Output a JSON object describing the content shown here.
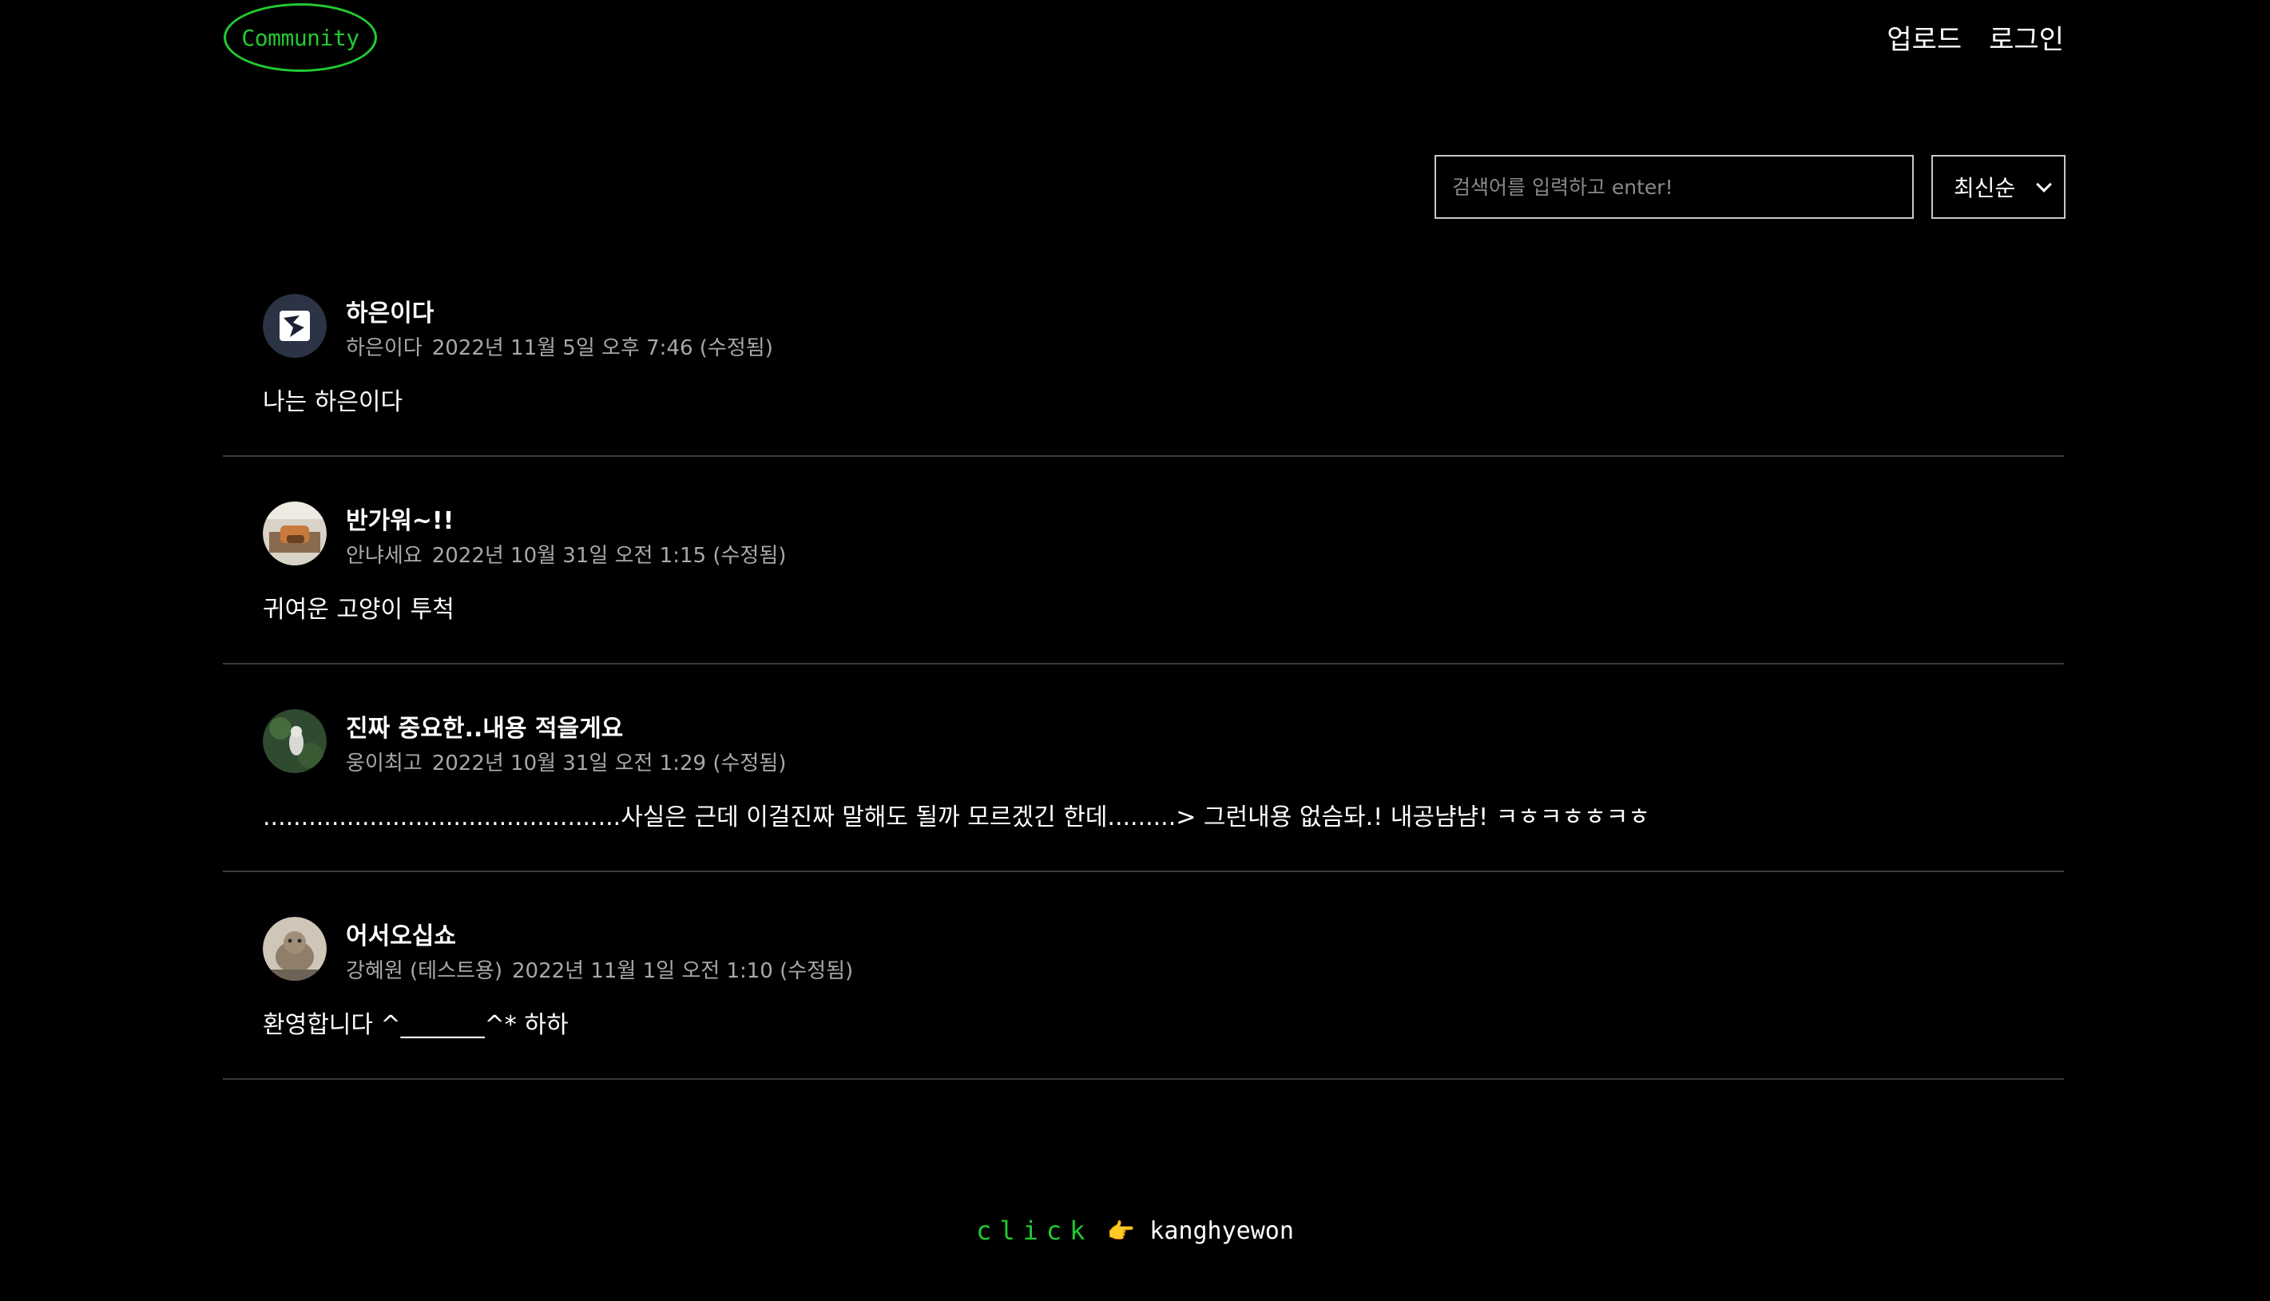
{
  "header": {
    "logo": "Community",
    "nav": [
      {
        "label": "업로드"
      },
      {
        "label": "로그인"
      }
    ]
  },
  "controls": {
    "search_placeholder": "검색어를 입력하고 enter!",
    "search_value": "",
    "sort_selected": "최신순"
  },
  "posts": [
    {
      "title": "하은이다",
      "author": "하은이다",
      "date": "2022년 11월 5일 오후 7:46 (수정됨)",
      "body": "나는 하은이다"
    },
    {
      "title": "반가워~!!",
      "author": "안냐세요",
      "date": "2022년 10월 31일 오전 1:15 (수정됨)",
      "body": "귀여운 고양이 투척"
    },
    {
      "title": "진짜 중요한..내용 적을게요",
      "author": "웅이최고",
      "date": "2022년 10월 31일 오전 1:29 (수정됨)",
      "body": "...............................................사실은 근데 이걸진짜 말해도 될까 모르겠긴 한데.........> 그런내용 없슴돠.! 내공냠냠! ㅋㅎㅋㅎㅎㅋㅎ"
    },
    {
      "title": "어서오십쇼",
      "author": "강혜원 (테스트용)",
      "date": "2022년 11월 1일 오전 1:10 (수정됨)",
      "body": "환영합니다 ^_______^* 하하"
    }
  ],
  "footer": {
    "click_text": "click",
    "icon": "pointing-hand-icon",
    "author_link": "kanghyewon"
  },
  "colors": {
    "background": "#000000",
    "accent_green": "#22c931",
    "divider": "#3a3a3a",
    "meta_text": "#a8a8a8"
  }
}
